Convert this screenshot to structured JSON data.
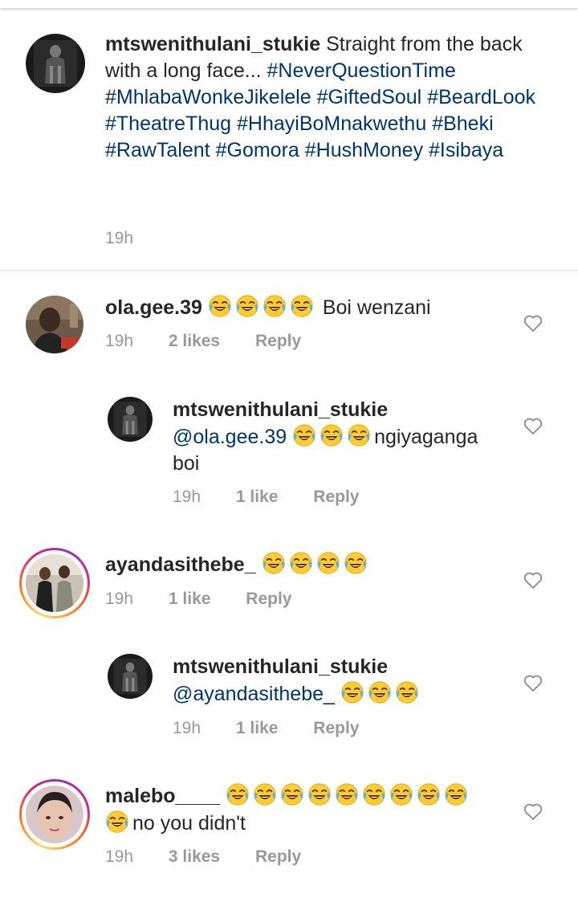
{
  "caption": {
    "username": "mtswenithulani_stukie",
    "text": "Straight from the back with a long face...",
    "hashtags": [
      "#NeverQuestionTime",
      "#MhlabaWonkeJikelele",
      "#GiftedSoul",
      "#BeardLook",
      "#TheatreThug",
      "#HhayiBoMnakwethu",
      "#Bheki",
      "#RawTalent",
      "#Gomora",
      "#HushMoney",
      "#Isibaya"
    ],
    "time": "19h"
  },
  "comments": [
    {
      "username": "ola.gee.39",
      "emoji_count": 4,
      "text": "Boi wenzani",
      "time": "19h",
      "likes": "2 likes",
      "reply": "Reply",
      "avatar_icon": "person-avatar-icon"
    },
    {
      "username": "mtswenithulani_stukie",
      "mention": "@ola.gee.39",
      "emoji_count": 3,
      "text_line1": "ngiyaganga",
      "text_line2": "boi",
      "time": "19h",
      "likes": "1 like",
      "reply": "Reply",
      "reply_to": "ola.gee.39"
    },
    {
      "username": "ayandasithebe_",
      "emoji_count": 4,
      "time": "19h",
      "likes": "1 like",
      "reply": "Reply",
      "has_story_ring": true
    },
    {
      "username": "mtswenithulani_stukie",
      "mention": "@ayandasithebe_",
      "emoji_count": 3,
      "time": "19h",
      "likes": "1 like",
      "reply": "Reply",
      "reply_to": "ayandasithebe_"
    },
    {
      "username": "malebo____",
      "emoji_count_line1": 9,
      "emoji_count_line2": 1,
      "text": "no you didn't",
      "time": "19h",
      "likes": "3 likes",
      "reply": "Reply",
      "has_story_ring": true
    }
  ],
  "icons": {
    "emoji": "face-with-tears-of-joy-icon",
    "like": "heart-outline-icon"
  },
  "colors": {
    "text": "#262626",
    "hashtag": "#003569",
    "meta": "#999999",
    "divider": "#dbdbdb"
  }
}
